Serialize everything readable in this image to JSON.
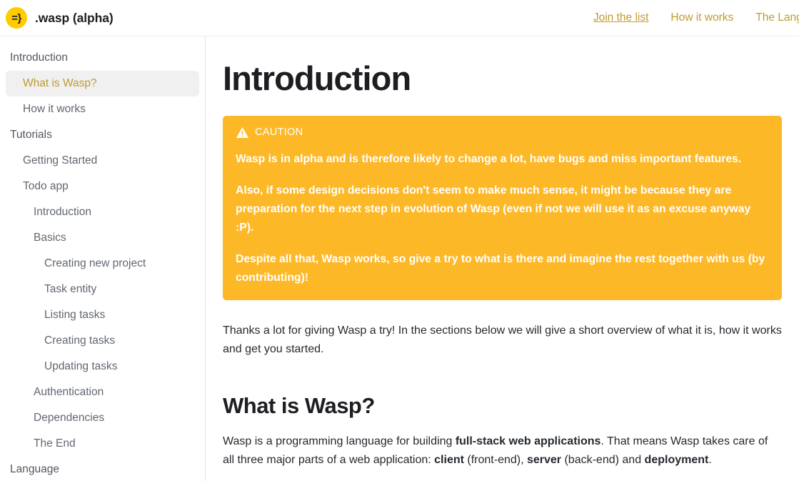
{
  "navbar": {
    "logo_glyph": "=}",
    "brand_title": ".wasp (alpha)",
    "links": [
      {
        "label": "Join the list",
        "underlined": true
      },
      {
        "label": "How it works",
        "underlined": false
      },
      {
        "label": "The Langua",
        "underlined": false
      }
    ]
  },
  "sidebar": {
    "items": [
      {
        "label": "Introduction",
        "level": "cat",
        "active": false
      },
      {
        "label": "What is Wasp?",
        "level": "lvl1",
        "active": true
      },
      {
        "label": "How it works",
        "level": "lvl1",
        "active": false
      },
      {
        "label": "Tutorials",
        "level": "cat",
        "active": false
      },
      {
        "label": "Getting Started",
        "level": "lvl1",
        "active": false
      },
      {
        "label": "Todo app",
        "level": "lvl1",
        "active": false
      },
      {
        "label": "Introduction",
        "level": "lvl2",
        "active": false
      },
      {
        "label": "Basics",
        "level": "lvl2",
        "active": false
      },
      {
        "label": "Creating new project",
        "level": "lvl3",
        "active": false
      },
      {
        "label": "Task entity",
        "level": "lvl3",
        "active": false
      },
      {
        "label": "Listing tasks",
        "level": "lvl3",
        "active": false
      },
      {
        "label": "Creating tasks",
        "level": "lvl3",
        "active": false
      },
      {
        "label": "Updating tasks",
        "level": "lvl3",
        "active": false
      },
      {
        "label": "Authentication",
        "level": "lvl2",
        "active": false
      },
      {
        "label": "Dependencies",
        "level": "lvl2",
        "active": false
      },
      {
        "label": "The End",
        "level": "lvl2",
        "active": false
      },
      {
        "label": "Language",
        "level": "cat",
        "active": false
      }
    ]
  },
  "main": {
    "title": "Introduction",
    "admonition": {
      "type": "caution",
      "label": "caution",
      "icon": "warning-triangle-icon",
      "background_color": "#fdb827",
      "paragraphs": [
        "Wasp is in alpha and is therefore likely to change a lot, have bugs and miss important features.",
        "Also, if some design decisions don't seem to make much sense, it might be because they are preparation for the next step in evolution of Wasp (even if not we will use it as an excuse anyway :P).",
        "Despite all that, Wasp works, so give a try to what is there and imagine the rest together with us (by contributing)!"
      ]
    },
    "intro_paragraph": "Thanks a lot for giving Wasp a try! In the sections below we will give a short overview of what it is, how it works and get you started.",
    "section_heading": "What is Wasp?",
    "section_paragraph": {
      "part1": "Wasp is a programming language for building ",
      "bold1": "full-stack web applications",
      "part2": ". That means Wasp takes care of all three major parts of a web application: ",
      "bold2": "client",
      "part3": " (front-end), ",
      "bold3": "server",
      "part4": " (back-end) and ",
      "bold4": "deployment",
      "part5": "."
    }
  },
  "colors": {
    "accent_gold": "#bf9b30",
    "admonition_orange": "#fdb827",
    "logo_yellow": "#ffcc00",
    "text_dark": "#1c1e21",
    "sidebar_text": "#606770",
    "active_bg": "#f0f0f0"
  }
}
